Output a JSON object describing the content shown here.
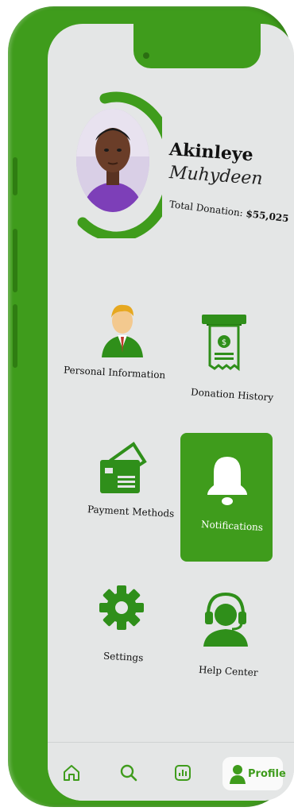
{
  "profile": {
    "first_name": "Akinleye",
    "last_name": "Muhydeen",
    "donation_label": "Total Donation:",
    "donation_value": "$55,025"
  },
  "menu": {
    "personal_info": "Personal Information",
    "donation_history": "Donation History",
    "payment_methods": "Payment Methods",
    "notifications": "Notifications",
    "settings": "Settings",
    "help_center": "Help Center"
  },
  "nav": {
    "home_icon": "home-icon",
    "search_icon": "search-icon",
    "stats_icon": "chart-icon",
    "profile_label": "Profile"
  },
  "colors": {
    "brand_green": "#3f9c1c",
    "screen_bg": "#e4e6e6"
  }
}
